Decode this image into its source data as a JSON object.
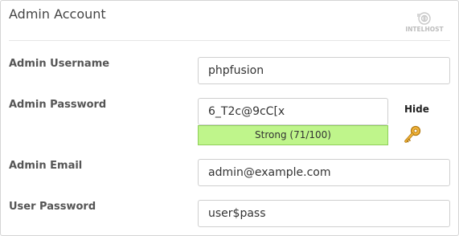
{
  "header": {
    "title": "Admin Account",
    "logo_text": "INTELHOST"
  },
  "form": {
    "admin_username": {
      "label": "Admin Username",
      "value": "phpfusion"
    },
    "admin_password": {
      "label": "Admin Password",
      "value": "6_T2c@9cC[x",
      "strength_text": "Strong (71/100)",
      "strength_score": 71,
      "strength_color": "#bff58b",
      "toggle_label": "Hide"
    },
    "admin_email": {
      "label": "Admin Email",
      "value": "admin@example.com"
    },
    "user_password": {
      "label": "User Password",
      "value": "user$pass"
    }
  },
  "icons": {
    "logo": "intelhost-logo",
    "generate": "key-icon"
  }
}
